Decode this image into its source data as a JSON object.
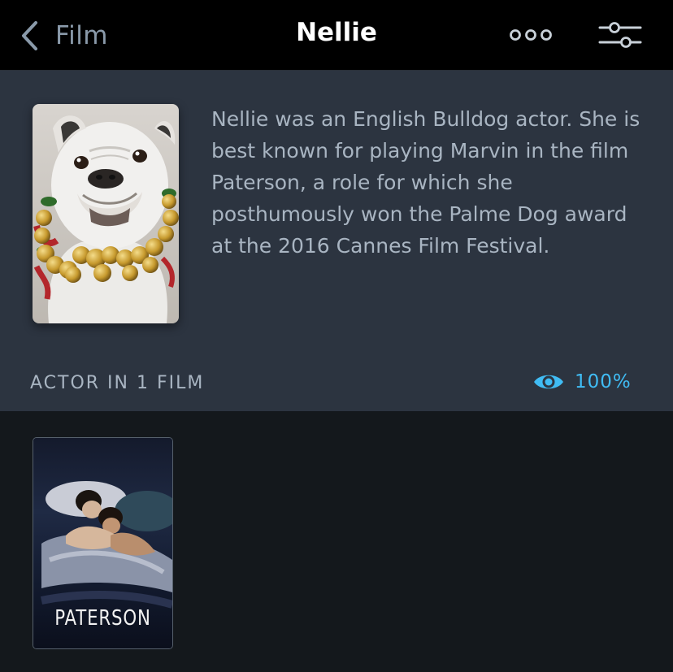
{
  "topbar": {
    "back_label": "Film",
    "title": "Nellie"
  },
  "icons": {
    "back": "chevron-left-icon",
    "more": "more-dots-icon",
    "filter": "sliders-icon",
    "eye": "eye-icon"
  },
  "bio": {
    "text": "Nellie was an English Bulldog actor. She is best known for playing Marvin in the film Paterson, a role for which she posthumously won the Palme Dog award at the 2016 Cannes Film Festival."
  },
  "filmography": {
    "label": "ACTOR IN 1 FILM",
    "watched_percent": "100%",
    "films": [
      {
        "poster_title": "PATERSON"
      }
    ]
  },
  "colors": {
    "accent": "#40bcf4",
    "topbar_bg": "#000000",
    "bio_bg": "#2c3440",
    "page_bg": "#14181c",
    "text_secondary": "#a9b5c2"
  }
}
